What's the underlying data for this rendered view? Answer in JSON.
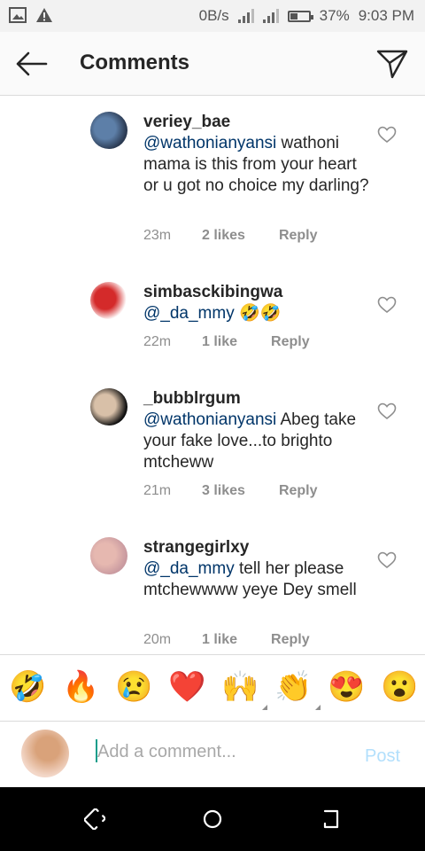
{
  "status_bar": {
    "net_speed": "0B/s",
    "battery": "37%",
    "battery_level": 0.37,
    "time": "9:03 PM"
  },
  "header": {
    "title": "Comments"
  },
  "comments": [
    {
      "username": "veriey_bae",
      "mention": "@wathonianyansi",
      "text": " wathoni mama is this from your heart or u got no choice my darling?",
      "time": "23m",
      "likes": "2 likes",
      "reply": "Reply",
      "avatar_colors": [
        "#2b3a52",
        "#5d7fa8"
      ]
    },
    {
      "username": "simbasckibingwa",
      "mention": "@_da_mmy",
      "text": " 🤣🤣",
      "time": "22m",
      "likes": "1 like",
      "reply": "Reply",
      "avatar_colors": [
        "#ffffff",
        "#d42a2a"
      ]
    },
    {
      "username": "_bubblrgum",
      "mention": "@wathonianyansi",
      "text": " Abeg take your fake love...to brighto mtcheww",
      "time": "21m",
      "likes": "3 likes",
      "reply": "Reply",
      "avatar_colors": [
        "#111111",
        "#d8c0a8"
      ]
    },
    {
      "username": "strangegirlxy",
      "mention": "@_da_mmy",
      "text": " tell her please mtchewwww yeye Dey smell",
      "time": "20m",
      "likes": "1 like",
      "reply": "Reply",
      "avatar_colors": [
        "#c99aa0",
        "#e6b8b0"
      ]
    }
  ],
  "emoji_bar": [
    "🤣",
    "🔥",
    "😢",
    "❤️",
    "🙌",
    "👏",
    "😍",
    "😮"
  ],
  "composer": {
    "placeholder": "Add a comment...",
    "post_label": "Post"
  },
  "colors": {
    "mention": "#003569",
    "meta": "#8e8e8e",
    "post_disabled": "#b2dffc",
    "cursor": "#0f9d8a"
  },
  "icons": {
    "back": "back-arrow-icon",
    "send": "paper-plane-icon",
    "like": "heart-outline-icon",
    "nav_back": "nav-back-icon",
    "nav_home": "nav-home-icon",
    "nav_recents": "nav-recents-icon"
  }
}
